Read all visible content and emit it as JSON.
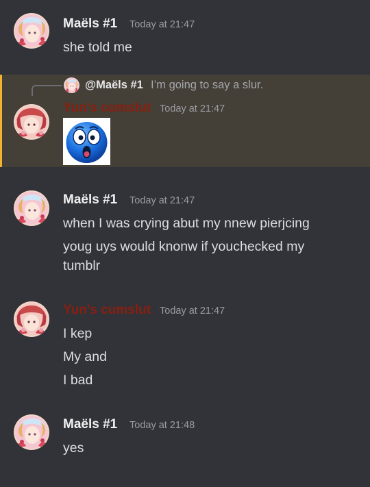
{
  "colors": {
    "maels_name": "#f0f1f3",
    "yun_name": "#8a1f10",
    "highlight_bg": "#443f37",
    "highlight_bar": "#f0b232"
  },
  "messages": [
    {
      "author": "Maëls #1",
      "timestamp": "Today at 21:47",
      "lines": [
        "she told me"
      ]
    },
    {
      "reply": {
        "author": "@Maëls #1",
        "text": "I’m going to say a slur."
      },
      "author": "Yun's cumslut",
      "timestamp": "Today at 21:47",
      "attachment_icon": "shocked-face-emoji"
    },
    {
      "author": "Maëls #1",
      "timestamp": "Today at 21:47",
      "lines": [
        "when I was crying abut my nnew pierjcing",
        "youg uys would knonw if youchecked my",
        "tumblr"
      ]
    },
    {
      "author": "Yun's cumslut",
      "timestamp": "Today at 21:47",
      "lines": [
        "I kep",
        "My and",
        "I bad"
      ]
    },
    {
      "author": "Maëls #1",
      "timestamp": "Today at 21:48",
      "lines": [
        "yes"
      ]
    }
  ]
}
